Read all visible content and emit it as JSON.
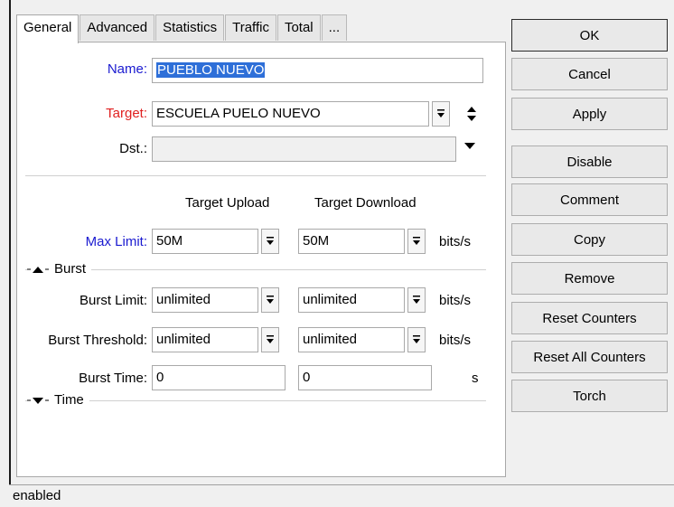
{
  "tabs": [
    "General",
    "Advanced",
    "Statistics",
    "Traffic",
    "Total",
    "..."
  ],
  "form": {
    "name_label": "Name:",
    "name_value": "PUEBLO NUEVO",
    "target_label": "Target:",
    "target_value": "ESCUELA PUELO NUEVO",
    "dst_label": "Dst.:",
    "dst_value": "",
    "target_upload_header": "Target Upload",
    "target_download_header": "Target Download",
    "max_limit_label": "Max Limit:",
    "max_limit_upload": "50M",
    "max_limit_download": "50M",
    "unit_bits": "bits/s",
    "burst_group": "Burst",
    "burst_limit_label": "Burst Limit:",
    "burst_limit_upload": "unlimited",
    "burst_limit_download": "unlimited",
    "burst_threshold_label": "Burst Threshold:",
    "burst_threshold_upload": "unlimited",
    "burst_threshold_download": "unlimited",
    "burst_time_label": "Burst Time:",
    "burst_time_upload": "0",
    "burst_time_download": "0",
    "unit_seconds": "s",
    "time_group": "Time"
  },
  "buttons": [
    "OK",
    "Cancel",
    "Apply",
    "Disable",
    "Comment",
    "Copy",
    "Remove",
    "Reset Counters",
    "Reset All Counters",
    "Torch"
  ],
  "status": "enabled",
  "colors": {
    "label_blue": "#1a1ad0",
    "label_red": "#e02020",
    "selection": "#2e6fd8"
  }
}
